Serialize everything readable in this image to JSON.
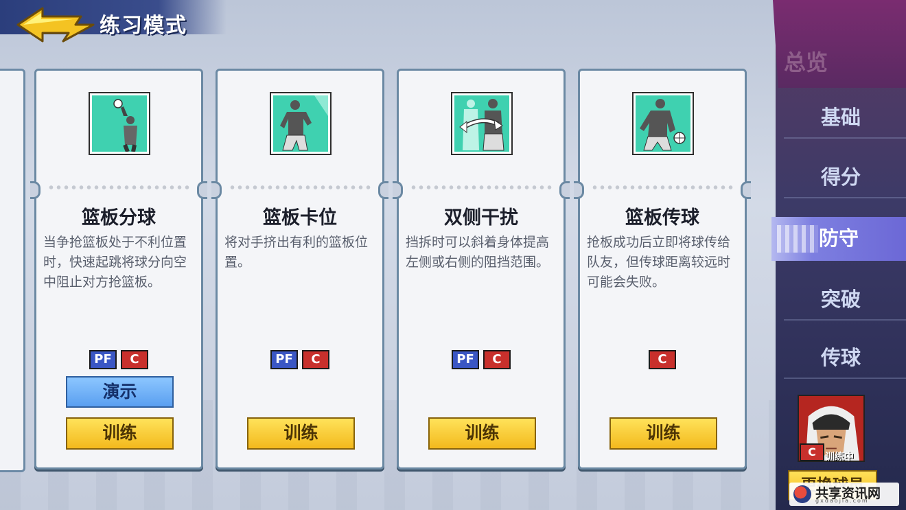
{
  "header": {
    "title": "练习模式"
  },
  "cards": [
    {
      "name": "篮板分球",
      "desc": "当争抢篮板处于不利位置时，快速起跳将球分向空中阻止对方抢篮板。",
      "badges": [
        "PF",
        "C"
      ],
      "demo": "演示",
      "train": "训练",
      "icon": "tip-ball-icon"
    },
    {
      "name": "篮板卡位",
      "desc": "将对手挤出有利的篮板位置。",
      "badges": [
        "PF",
        "C"
      ],
      "train": "训练",
      "icon": "box-out-icon"
    },
    {
      "name": "双侧干扰",
      "desc": "挡拆时可以斜着身体提高左侧或右侧的阻挡范围。",
      "badges": [
        "PF",
        "C"
      ],
      "train": "训练",
      "icon": "side-block-icon"
    },
    {
      "name": "篮板传球",
      "desc": "抢板成功后立即将球传给队友，但传球距离较远时可能会失败。",
      "badges": [
        "C"
      ],
      "train": "训练",
      "icon": "rebound-pass-icon"
    }
  ],
  "sidebar": {
    "overview": "总览",
    "items": [
      {
        "label": "基础",
        "active": false
      },
      {
        "label": "得分",
        "active": false
      },
      {
        "label": "防守",
        "active": true
      },
      {
        "label": "突破",
        "active": false
      },
      {
        "label": "传球",
        "active": false
      }
    ],
    "player": {
      "position": "C",
      "status": "训练中"
    },
    "change_button": "更换球员"
  },
  "watermark": {
    "text": "共享资讯网",
    "sub": "gxdaojia.com"
  },
  "colors": {
    "accent_teal": "#3fd1b0",
    "pf_badge": "#3a56c4",
    "c_badge": "#c8302c",
    "train_yellow": "#f3b91d",
    "demo_blue": "#5a9ff0"
  }
}
